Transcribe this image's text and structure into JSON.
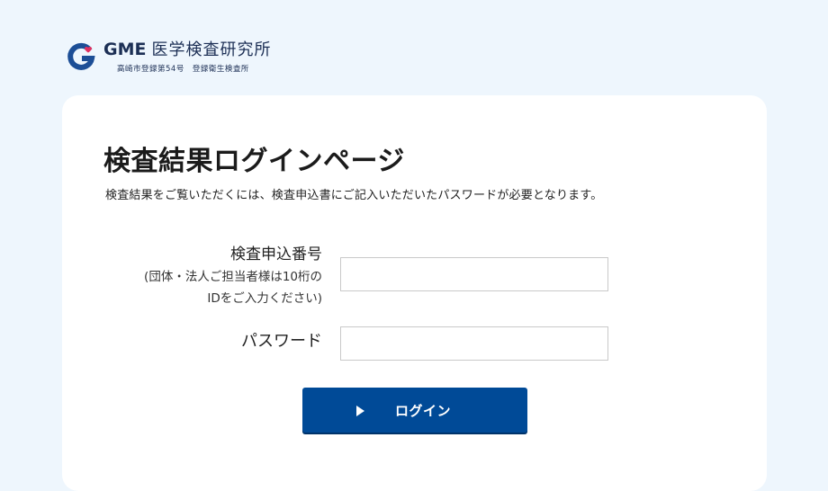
{
  "header": {
    "logo_brand": "GME",
    "logo_name": "医学検査研究所",
    "logo_sub": "高崎市登録第54号　登録衛生検査所",
    "logo_icon": "gme-logo-mark"
  },
  "page": {
    "title": "検査結果ログインページ",
    "description": "検査結果をご覧いただくには、検査申込書にご記入いただいたパスワードが必要となります。"
  },
  "form": {
    "application_number": {
      "label": "検査申込番号",
      "note_line1": "(団体・法人ご担当者様は10桁の",
      "note_line2": "IDをご入力ください)",
      "value": "",
      "placeholder": ""
    },
    "password": {
      "label": "パスワード",
      "value": "",
      "placeholder": ""
    },
    "submit": {
      "label": "ログイン",
      "icon": "play-icon"
    }
  },
  "colors": {
    "background": "#eef6fd",
    "card": "#ffffff",
    "button": "#004a97",
    "brand_navy": "#1c2f55",
    "logo_heart": "#e03060"
  }
}
